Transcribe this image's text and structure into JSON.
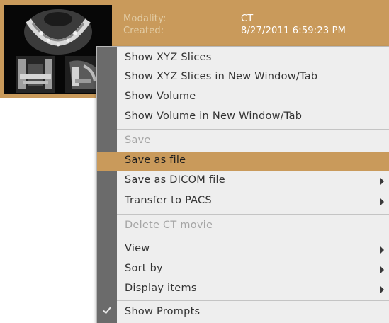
{
  "card": {
    "modality_label": "Modality:",
    "modality_value": "CT",
    "created_label": "Created:",
    "created_value": "8/27/2011 6:59:23 PM"
  },
  "menu": {
    "items": [
      {
        "label": "Show XYZ Slices",
        "enabled": true
      },
      {
        "label": "Show XYZ Slices in New Window/Tab",
        "enabled": true
      },
      {
        "label": "Show Volume",
        "enabled": true
      },
      {
        "label": "Show Volume in New Window/Tab",
        "enabled": true
      },
      {
        "label": "Save",
        "enabled": false
      },
      {
        "label": "Save as file",
        "enabled": true,
        "highlighted": true
      },
      {
        "label": "Save as DICOM file",
        "enabled": true,
        "submenu": true
      },
      {
        "label": "Transfer to PACS",
        "enabled": true,
        "submenu": true
      },
      {
        "label": "Delete CT movie",
        "enabled": false
      },
      {
        "label": "View",
        "enabled": true,
        "submenu": true
      },
      {
        "label": "Sort by",
        "enabled": true,
        "submenu": true
      },
      {
        "label": "Display items",
        "enabled": true,
        "submenu": true
      },
      {
        "label": "Show Prompts",
        "enabled": true,
        "checked": true
      }
    ]
  },
  "colors": {
    "selection": "#c99a5b",
    "menu_background": "#eeeeee",
    "gutter": "#6b6b6b",
    "disabled_text": "#a5a5a5"
  }
}
